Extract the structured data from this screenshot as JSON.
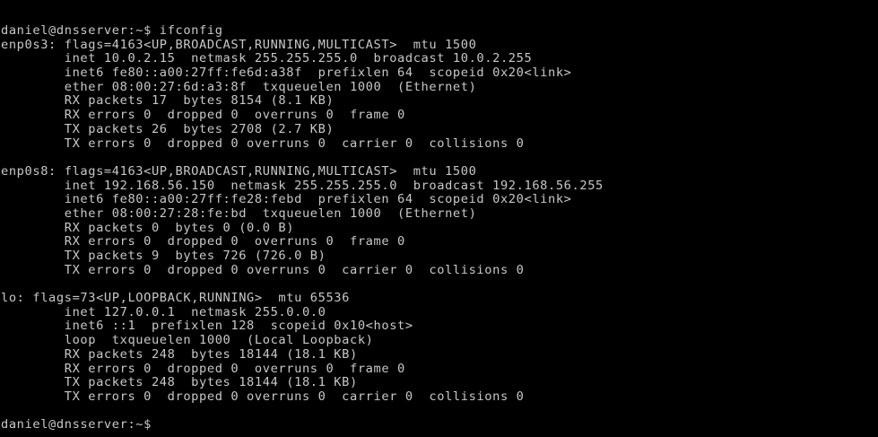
{
  "terminal": {
    "lines": [
      "daniel@dnsserver:~$ ifconfig",
      "enp0s3: flags=4163<UP,BROADCAST,RUNNING,MULTICAST>  mtu 1500",
      "        inet 10.0.2.15  netmask 255.255.255.0  broadcast 10.0.2.255",
      "        inet6 fe80::a00:27ff:fe6d:a38f  prefixlen 64  scopeid 0x20<link>",
      "        ether 08:00:27:6d:a3:8f  txqueuelen 1000  (Ethernet)",
      "        RX packets 17  bytes 8154 (8.1 KB)",
      "        RX errors 0  dropped 0  overruns 0  frame 0",
      "        TX packets 26  bytes 2708 (2.7 KB)",
      "        TX errors 0  dropped 0 overruns 0  carrier 0  collisions 0",
      "",
      "enp0s8: flags=4163<UP,BROADCAST,RUNNING,MULTICAST>  mtu 1500",
      "        inet 192.168.56.150  netmask 255.255.255.0  broadcast 192.168.56.255",
      "        inet6 fe80::a00:27ff:fe28:febd  prefixlen 64  scopeid 0x20<link>",
      "        ether 08:00:27:28:fe:bd  txqueuelen 1000  (Ethernet)",
      "        RX packets 0  bytes 0 (0.0 B)",
      "        RX errors 0  dropped 0  overruns 0  frame 0",
      "        TX packets 9  bytes 726 (726.0 B)",
      "        TX errors 0  dropped 0 overruns 0  carrier 0  collisions 0",
      "",
      "lo: flags=73<UP,LOOPBACK,RUNNING>  mtu 65536",
      "        inet 127.0.0.1  netmask 255.0.0.0",
      "        inet6 ::1  prefixlen 128  scopeid 0x10<host>",
      "        loop  txqueuelen 1000  (Local Loopback)",
      "        RX packets 248  bytes 18144 (18.1 KB)",
      "        RX errors 0  dropped 0  overruns 0  frame 0",
      "        TX packets 248  bytes 18144 (18.1 KB)",
      "        TX errors 0  dropped 0 overruns 0  carrier 0  collisions 0",
      "",
      "daniel@dnsserver:~$"
    ],
    "colors": {
      "background": "#000000",
      "text": "#c8c8c8"
    }
  }
}
